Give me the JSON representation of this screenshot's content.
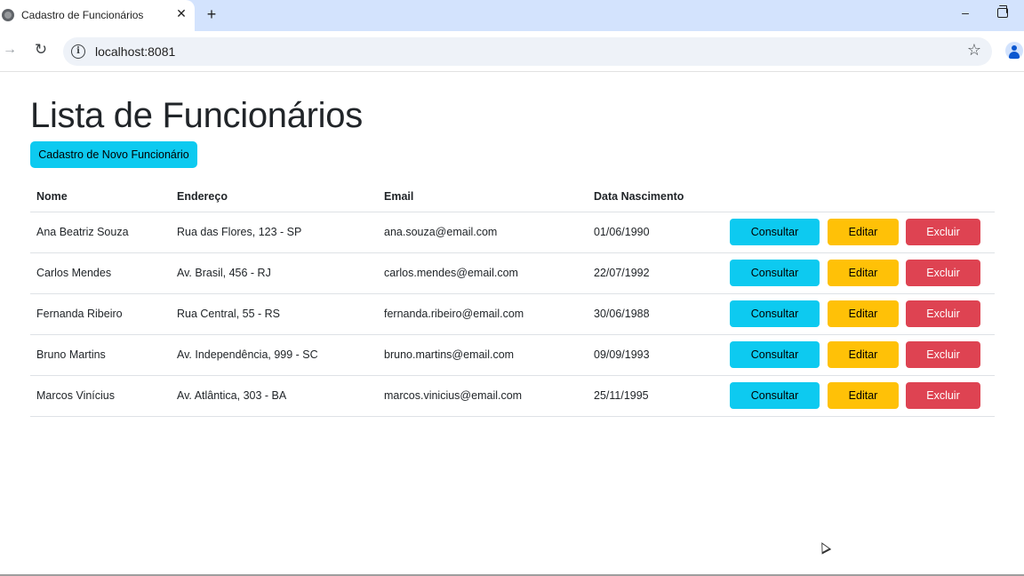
{
  "browser": {
    "tab_title": "Cadastro de Funcionários",
    "tab_close": "✕",
    "new_tab": "+",
    "minimize": "–",
    "url": "localhost:8081",
    "icons": [
      "globe-icon",
      "close-icon",
      "plus-icon",
      "minimize-icon",
      "restore-icon",
      "forward-icon",
      "reload-icon",
      "info-icon",
      "star-icon",
      "profile-icon"
    ]
  },
  "page": {
    "title": "Lista de Funcionários",
    "new_button": "Cadastro de Novo Funcionário"
  },
  "table": {
    "headers": [
      "Nome",
      "Endereço",
      "Email",
      "Data Nascimento"
    ],
    "rows": [
      [
        "Ana Beatriz Souza",
        "Rua das Flores, 123 - SP",
        "ana.souza@email.com",
        "01/06/1990"
      ],
      [
        "Carlos Mendes",
        "Av. Brasil, 456 - RJ",
        "carlos.mendes@email.com",
        "22/07/1992"
      ],
      [
        "Fernanda Ribeiro",
        "Rua Central, 55 - RS",
        "fernanda.ribeiro@email.com",
        "30/06/1988"
      ],
      [
        "Bruno Martins",
        "Av. Independência, 999 - SC",
        "bruno.martins@email.com",
        "09/09/1993"
      ],
      [
        "Marcos Vinícius",
        "Av. Atlântica, 303 - BA",
        "marcos.vinicius@email.com",
        "25/11/1995"
      ]
    ],
    "actions": {
      "consultar": "Consultar",
      "editar": "Editar",
      "excluir": "Excluir"
    }
  },
  "colors": {
    "info": "#0dcaf0",
    "warning": "#ffc107",
    "danger": "#dc3545",
    "tabstrip": "#d3e3fd"
  }
}
